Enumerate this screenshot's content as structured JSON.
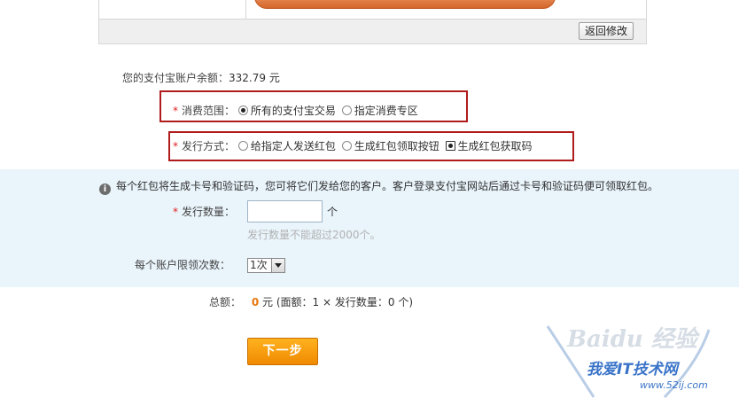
{
  "preview": {
    "back_button": "返回修改"
  },
  "balance": {
    "label": "您的支付宝账户余额：",
    "value": "332.79 元"
  },
  "scope": {
    "required_mark": "*",
    "label": "消费范围：",
    "options": [
      {
        "label": "所有的支付宝交易",
        "checked": true
      },
      {
        "label": "指定消费专区",
        "checked": false
      }
    ]
  },
  "issue_method": {
    "required_mark": "*",
    "label": "发行方式：",
    "options": [
      {
        "label": "给指定人发送红包",
        "checked": false
      },
      {
        "label": "生成红包领取按钮",
        "checked": false
      },
      {
        "label": "生成红包获取码",
        "checked": true
      }
    ]
  },
  "info": {
    "icon": "info-icon",
    "text": "每个红包将生成卡号和验证码，您可将它们发给您的客户。客户登录支付宝网站后通过卡号和验证码便可领取红包。"
  },
  "quantity": {
    "required_mark": "*",
    "label": "发行数量：",
    "value": "",
    "unit": "个",
    "hint": "发行数量不能超过2000个。"
  },
  "limit": {
    "label": "每个账户限领次数：",
    "selected": "1次"
  },
  "total": {
    "label": "总额：",
    "amount": "0",
    "unit": "元",
    "detail": "(面额：1 × 发行数量：0 个)"
  },
  "next_button": "下一步",
  "watermark": {
    "brand": "Baidu 经验",
    "site_name": "我爱IT技术网",
    "url": "www.52ij.com"
  },
  "colors": {
    "highlight_box": "#b01c1c",
    "info_band": "#e9f4fb",
    "next_button": "#f5a00c",
    "required": "#e02020"
  }
}
